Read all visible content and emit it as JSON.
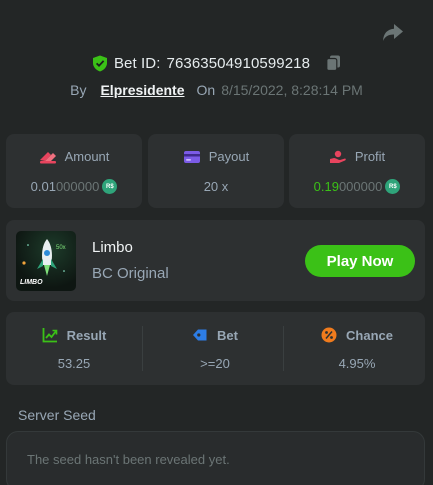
{
  "header": {
    "bet_id_label": "Bet ID:",
    "bet_id": "76363504910599218",
    "by_label": "By",
    "username": "Elpresidente",
    "on_label": "On",
    "date": "8/15/2022, 8:28:14 PM"
  },
  "stats": {
    "amount": {
      "label": "Amount",
      "value_bright": "0.01",
      "value_dim": "000000",
      "currency": "R$"
    },
    "payout": {
      "label": "Payout",
      "value": "20 x"
    },
    "profit": {
      "label": "Profit",
      "value_bright": "0.19",
      "value_dim": "000000",
      "currency": "R$"
    }
  },
  "game": {
    "name": "Limbo",
    "subtitle": "BC Original",
    "thumb_brand": "LIMBO",
    "play_label": "Play Now"
  },
  "result": {
    "result_label": "Result",
    "result_value": "53.25",
    "bet_label": "Bet",
    "bet_value": ">=20",
    "chance_label": "Chance",
    "chance_value": "4.95%"
  },
  "seed": {
    "label": "Server Seed",
    "message": "The seed hasn't been revealed yet."
  },
  "colors": {
    "background": "#232626",
    "card": "#2d3031",
    "accent_green": "#3bc117",
    "profit_green": "#3bc117",
    "coin": "#2fa47a",
    "shield_green": "#3bc117"
  },
  "icons": {
    "share": "share-icon",
    "shield": "shield-check-icon",
    "copy": "copy-icon",
    "amount": "bet-amount-icon",
    "payout": "wallet-card-icon",
    "profit": "profit-hand-icon",
    "result": "trend-chart-icon",
    "bet": "tag-icon",
    "chance": "percent-icon"
  }
}
